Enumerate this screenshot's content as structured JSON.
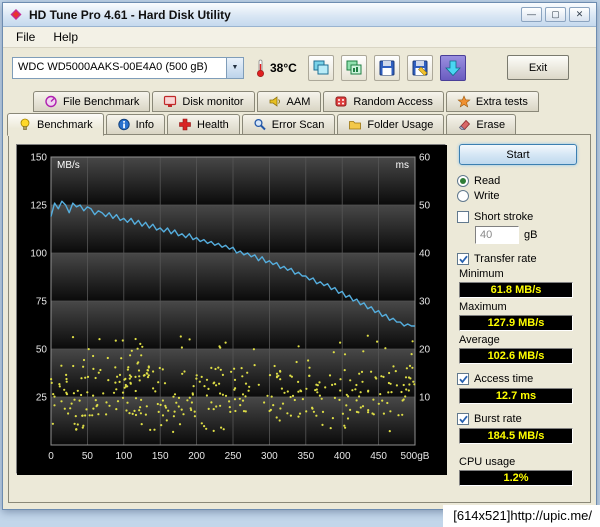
{
  "desktop": {
    "watermark": "[614x521]http://upic.me/"
  },
  "window": {
    "title": "HD Tune Pro 4.61 - Hard Disk Utility",
    "controls": {
      "minimize": "—",
      "maximize": "▢",
      "close": "✕"
    },
    "menu": [
      "File",
      "Help"
    ],
    "toolbar": {
      "drive": "WDC WD5000AAKS-00E4A0  (500 gB)",
      "combo_arrow": "▼",
      "temperature": "38°C",
      "exit": "Exit"
    }
  },
  "tabs": {
    "row1": [
      "File Benchmark",
      "Disk monitor",
      "AAM",
      "Random Access",
      "Extra tests"
    ],
    "row2": [
      "Benchmark",
      "Info",
      "Health",
      "Error Scan",
      "Folder Usage",
      "Erase"
    ],
    "active": "Benchmark"
  },
  "panel": {
    "start": "Start",
    "read": "Read",
    "write": "Write",
    "short_stroke": "Short stroke",
    "short_stroke_value": "40",
    "short_stroke_unit": "gB",
    "transfer_rate": "Transfer rate",
    "minimum": {
      "label": "Minimum",
      "value": "61.8 MB/s"
    },
    "maximum": {
      "label": "Maximum",
      "value": "127.9 MB/s"
    },
    "average": {
      "label": "Average",
      "value": "102.6 MB/s"
    },
    "access_time": {
      "label": "Access time",
      "value": "12.7 ms"
    },
    "burst_rate": {
      "label": "Burst rate",
      "value": "184.5 MB/s"
    },
    "cpu_usage": {
      "label": "CPU usage",
      "value": "1.2%"
    }
  },
  "chart_data": {
    "type": "line+scatter",
    "title": "HD Tune benchmark: transfer rate (blue line, MB/s) and access time (yellow dots, ms) across disk position 0-500 gB",
    "background": "#000000",
    "x_axis": {
      "min": 0,
      "max": 500,
      "tick_values": [
        0,
        50,
        100,
        150,
        200,
        250,
        300,
        350,
        400,
        450,
        500
      ],
      "tick_labels": [
        "0",
        "50",
        "100",
        "150",
        "200",
        "250",
        "300",
        "350",
        "400",
        "450",
        "500gB"
      ]
    },
    "left_axis": {
      "label": "MB/s",
      "min": 0,
      "max": 150,
      "tick_values": [
        25,
        50,
        75,
        100,
        125,
        150
      ]
    },
    "right_axis": {
      "label": "ms",
      "min": 0,
      "max": 60,
      "tick_values": [
        10,
        20,
        30,
        40,
        50,
        60
      ]
    },
    "grid": true,
    "series": [
      {
        "name": "Transfer rate",
        "type": "line",
        "color": "#55aede",
        "axis": "left",
        "x_start": 0,
        "x_step": 5,
        "values": [
          119,
          126,
          123,
          127,
          125,
          121,
          126,
          124,
          125,
          122,
          124,
          123,
          120,
          122,
          121,
          119,
          121,
          118,
          120,
          117,
          118,
          116,
          118,
          115,
          117,
          114,
          116,
          113,
          115,
          112,
          113,
          111,
          113,
          110,
          112,
          109,
          110,
          108,
          110,
          107,
          108,
          106,
          107,
          105,
          106,
          104,
          105,
          103,
          104,
          102,
          103,
          100,
          101,
          99,
          100,
          98,
          99,
          96,
          98,
          95,
          96,
          94,
          95,
          92,
          93,
          91,
          92,
          89,
          90,
          88,
          88,
          86,
          87,
          84,
          85,
          83,
          84,
          81,
          82,
          79,
          80,
          77,
          78,
          75,
          76,
          73,
          74,
          71,
          72,
          69,
          70,
          67,
          68,
          65,
          66,
          64,
          64,
          62,
          63,
          62,
          62
        ]
      },
      {
        "name": "Access time",
        "type": "scatter",
        "color": "#dede46",
        "axis": "right",
        "seed": 42,
        "count": 380,
        "ms_min": 2.5,
        "ms_typical_min": 6,
        "ms_typical_max": 16.5,
        "ms_max": 23
      }
    ],
    "summary": {
      "minimum_mbs": 61.8,
      "maximum_mbs": 127.9,
      "average_mbs": 102.6,
      "access_time_ms": 12.7,
      "burst_rate_mbs": 184.5,
      "cpu_usage_pct": 1.2
    }
  }
}
